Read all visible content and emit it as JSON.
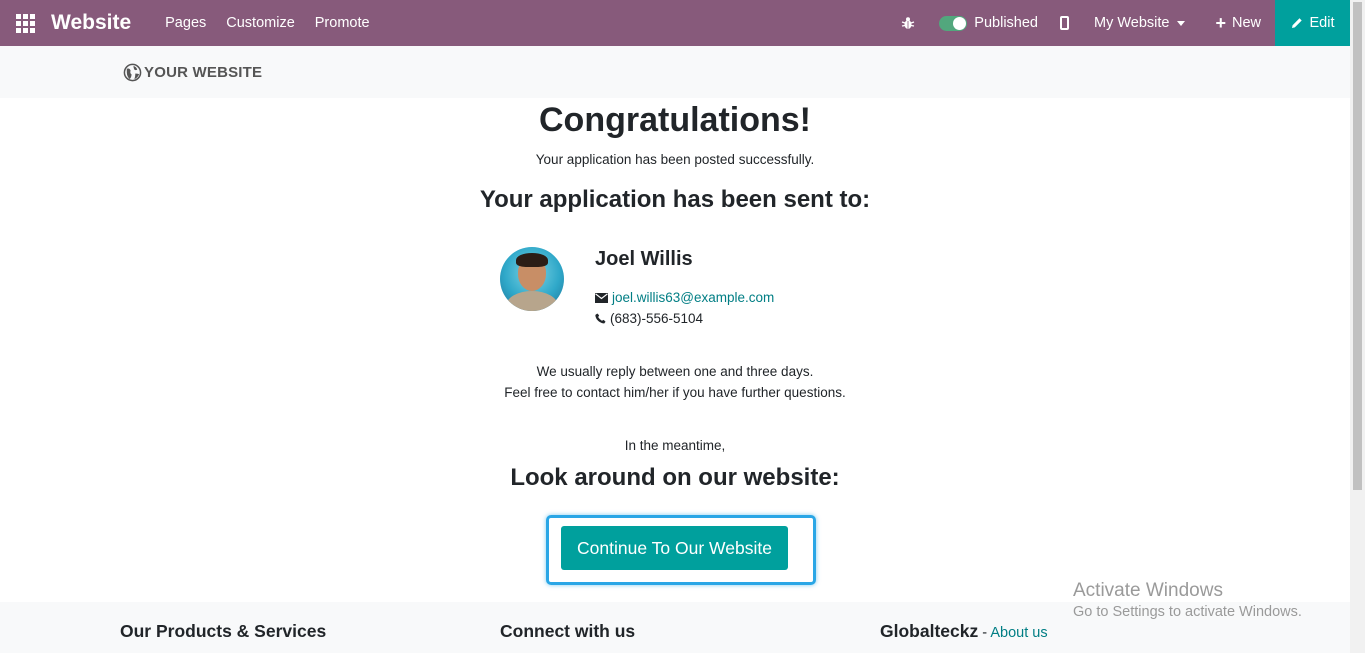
{
  "navbar": {
    "brand": "Website",
    "menu": [
      "Pages",
      "Customize",
      "Promote"
    ],
    "published_label": "Published",
    "website_selector": "My Website",
    "new_label": "New",
    "edit_label": "Edit",
    "bg_color": "#875a7b",
    "edit_bg_color": "#00a09d"
  },
  "site_header": {
    "logo_text": "YOUR WEBSITE"
  },
  "main": {
    "title": "Congratulations!",
    "posted_text": "Your application has been posted successfully.",
    "sent_to_heading": "Your application has been sent to:",
    "recruiter": {
      "name": "Joel Willis",
      "email": "joel.willis63@example.com",
      "phone": "(683)-556-5104"
    },
    "reply_line1": "We usually reply between one and three days.",
    "reply_line2": "Feel free to contact him/her if you have further questions.",
    "meantime_text": "In the meantime,",
    "look_heading": "Look around on our website:",
    "continue_button": "Continue To Our Website",
    "accent_color": "#00a09d",
    "link_color": "#017e84"
  },
  "footer": {
    "col1_title": "Our Products & Services",
    "col2_title": "Connect with us",
    "col3_title": "Globalteckz",
    "col3_sep": " - ",
    "col3_link": "About us"
  },
  "watermark": {
    "line1": "Activate Windows",
    "line2": "Go to Settings to activate Windows."
  }
}
